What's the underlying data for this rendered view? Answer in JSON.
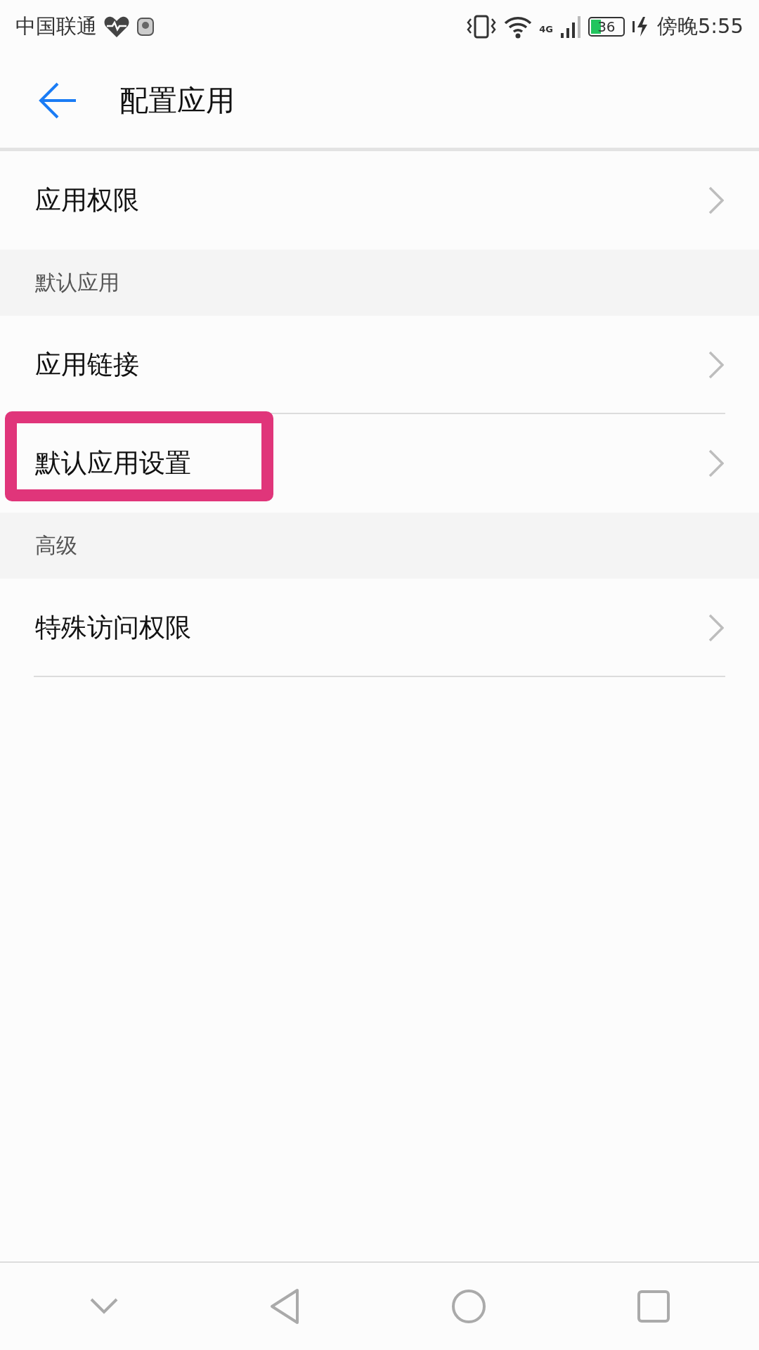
{
  "status_bar": {
    "carrier": "中国联通",
    "network": "4G",
    "battery": "36",
    "time": "傍晚5:55"
  },
  "header": {
    "title": "配置应用"
  },
  "list": [
    {
      "kind": "item",
      "label": "应用权限",
      "highlighted": false
    },
    {
      "kind": "section",
      "label": "默认应用"
    },
    {
      "kind": "item",
      "label": "应用链接",
      "highlighted": false
    },
    {
      "kind": "item",
      "label": "默认应用设置",
      "highlighted": true
    },
    {
      "kind": "section",
      "label": "高级"
    },
    {
      "kind": "item",
      "label": "特殊访问权限",
      "highlighted": false
    }
  ]
}
